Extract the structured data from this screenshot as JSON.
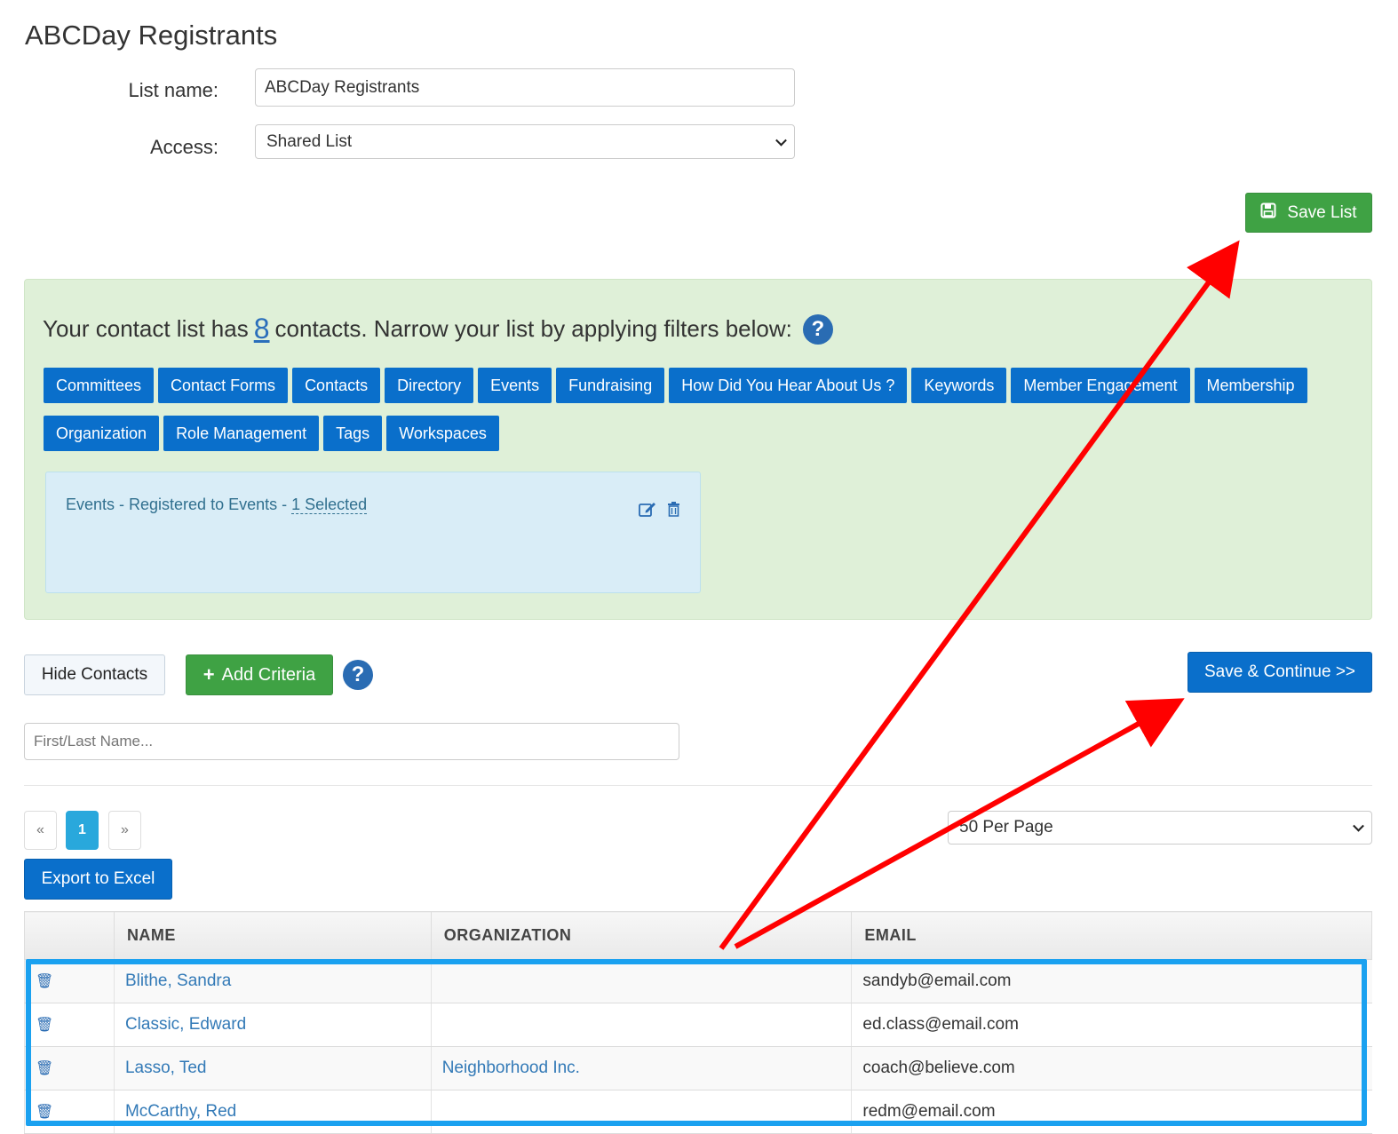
{
  "page": {
    "title": "ABCDay Registrants"
  },
  "form": {
    "list_name_label": "List name:",
    "list_name_value": "ABCDay Registrants",
    "access_label": "Access:",
    "access_value": "Shared List"
  },
  "buttons": {
    "save_list": "Save List",
    "hide_contacts": "Hide Contacts",
    "add_criteria": "Add Criteria",
    "save_continue": "Save & Continue >>",
    "export_excel": "Export to Excel"
  },
  "filter": {
    "summary_pre": "Your contact list has",
    "count": "8",
    "summary_post": "contacts. Narrow your list by applying filters below:",
    "help": "?",
    "categories_row1": [
      "Committees",
      "Contact Forms",
      "Contacts",
      "Directory",
      "Events",
      "Fundraising",
      "How Did You Hear About Us ?",
      "Keywords",
      "Member Engagement",
      "Membership"
    ],
    "categories_row2": [
      "Organization",
      "Role Management",
      "Tags",
      "Workspaces"
    ],
    "criteria": {
      "text": "Events - Registered to Events - ",
      "selected": "1 Selected"
    }
  },
  "search": {
    "placeholder": "First/Last Name..."
  },
  "pagination": {
    "prev": "«",
    "current": "1",
    "next": "»",
    "per_page": "50 Per Page"
  },
  "table": {
    "headers": [
      "",
      "NAME",
      "ORGANIZATION",
      "EMAIL"
    ],
    "rows": [
      {
        "name": "Blithe, Sandra",
        "organization": "",
        "email": "sandyb@email.com"
      },
      {
        "name": "Classic, Edward",
        "organization": "",
        "email": "ed.class@email.com"
      },
      {
        "name": "Lasso, Ted",
        "organization": "Neighborhood Inc.",
        "email": "coach@believe.com"
      },
      {
        "name": "McCarthy, Red",
        "organization": "",
        "email": "redm@email.com"
      }
    ]
  },
  "colors": {
    "primary_blue": "#0a6fcb",
    "success_green": "#3fa244",
    "panel_green": "#dff0d8",
    "criteria_blue": "#d9edf7",
    "annotation_red": "#ff0000",
    "highlight_blue": "#1aa1f0"
  },
  "icons": {
    "save": "floppy-disk-icon",
    "help": "question-circle-icon",
    "edit": "edit-icon",
    "delete": "trash-icon",
    "add": "plus-icon",
    "dropdown": "chevron-down-icon"
  }
}
